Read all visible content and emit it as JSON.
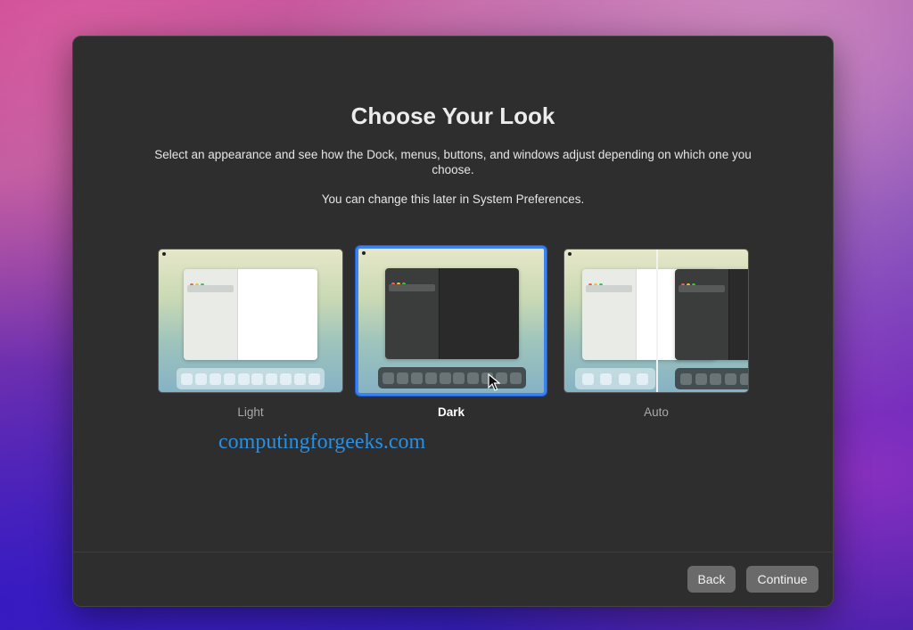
{
  "dialog": {
    "title": "Choose Your Look",
    "subtitle": "Select an appearance and see how the Dock, menus, buttons, and windows adjust depending on which one you choose.",
    "note": "You can change this later in System Preferences."
  },
  "options": [
    {
      "label": "Light",
      "selected": false
    },
    {
      "label": "Dark",
      "selected": true
    },
    {
      "label": "Auto",
      "selected": false
    }
  ],
  "footer": {
    "back_label": "Back",
    "continue_label": "Continue"
  },
  "watermark": "computingforgeeks.com",
  "colors": {
    "accent": "#3b82f0",
    "dialog_bg": "#2e2e2e",
    "button_bg": "#6a6a6a"
  },
  "icons": [
    "mouse-cursor-icon",
    "traffic-lights-icon"
  ]
}
